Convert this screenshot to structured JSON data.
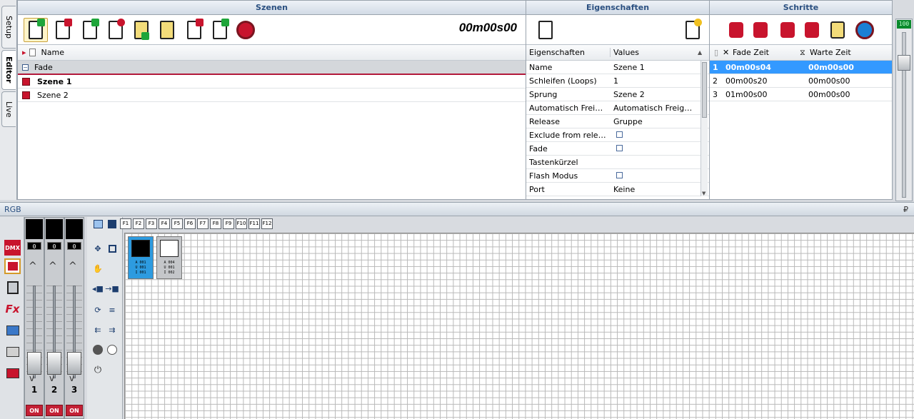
{
  "tabs": {
    "setup": "Setup",
    "editor": "Editor",
    "live": "Live"
  },
  "szenen": {
    "title": "Szenen",
    "time": "00m00s00",
    "column_name": "Name",
    "group": "Fade",
    "items": [
      "Szene 1",
      "Szene 2"
    ]
  },
  "eigenschaften": {
    "title": "Eigenschaften",
    "col_prop": "Eigenschaften",
    "col_val": "Values",
    "rows": [
      {
        "k": "Name",
        "v": "Szene 1"
      },
      {
        "k": "Schleifen (Loops)",
        "v": "1"
      },
      {
        "k": "Sprung",
        "v": "Szene 2"
      },
      {
        "k": "Automatisch Freigeb...",
        "v": "Automatisch Freigeb..."
      },
      {
        "k": "Release",
        "v": "Gruppe"
      },
      {
        "k": "Exclude from release",
        "v": ""
      },
      {
        "k": "Fade",
        "v": ""
      },
      {
        "k": "Tastenkürzel",
        "v": ""
      },
      {
        "k": "Flash Modus",
        "v": ""
      },
      {
        "k": "Port",
        "v": "Keine"
      }
    ]
  },
  "schritte": {
    "title": "Schritte",
    "col_fade": "Fade Zeit",
    "col_warte": "Warte Zeit",
    "rows": [
      {
        "n": "1",
        "fade": "00m00s04",
        "warte": "00m00s00"
      },
      {
        "n": "2",
        "fade": "00m00s20",
        "warte": "00m00s00"
      },
      {
        "n": "3",
        "fade": "01m00s00",
        "warte": "00m00s00"
      }
    ]
  },
  "meter": {
    "value": "100"
  },
  "rgb": {
    "title": "RGB",
    "pin": "₽",
    "dmx_label": "DMX",
    "fx_label": "Fx",
    "fkeys": [
      "F1",
      "F2",
      "F3",
      "F4",
      "F5",
      "F6",
      "F7",
      "F8",
      "F9",
      "F10",
      "F11",
      "F12"
    ],
    "faders": [
      {
        "value": "0",
        "channel": "1",
        "on": "ON"
      },
      {
        "value": "0",
        "channel": "2",
        "on": "ON"
      },
      {
        "value": "0",
        "channel": "3",
        "on": "ON"
      }
    ],
    "tiles": [
      {
        "l1": "A 001",
        "l2": "U 001",
        "l3": "I 001"
      },
      {
        "l1": "A 004",
        "l2": "U 001",
        "l3": "I 002"
      }
    ]
  },
  "colors": {
    "accent": "#2a4f80",
    "selection": "#3399ff",
    "scene_red": "#c8142d",
    "on_red": "#c42035",
    "meter_green": "#0a8a2c"
  }
}
